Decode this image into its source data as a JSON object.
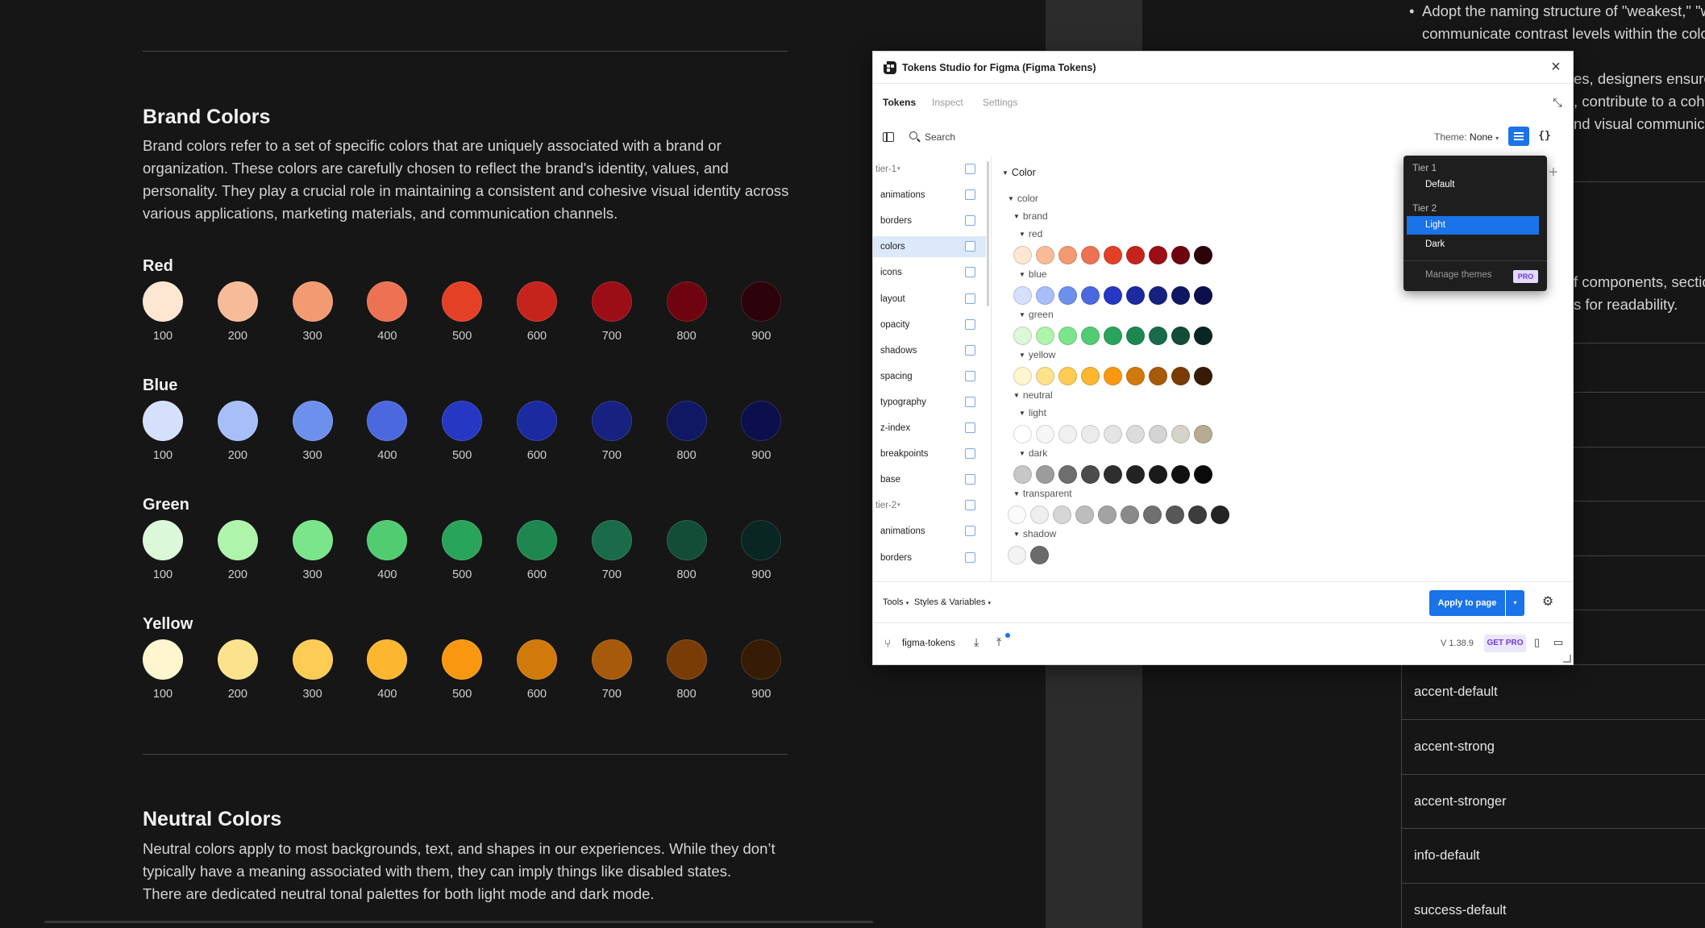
{
  "doc": {
    "brand_title": "Brand Colors",
    "brand_paragraph": [
      "Brand colors refer to a set of specific colors that are uniquely associated with a brand or",
      "organization. These colors are carefully chosen to reflect the brand's identity, values, and",
      "personality. They play a crucial role in maintaining a consistent and cohesive visual identity across",
      "various applications, marketing materials, and communication channels."
    ],
    "palettes": [
      {
        "name": "Red",
        "colors": [
          "#fde6d2",
          "#f8bb97",
          "#f29a72",
          "#ec7253",
          "#e44026",
          "#c4241c",
          "#9b0e16",
          "#6f0411",
          "#2c030a"
        ]
      },
      {
        "name": "Blue",
        "colors": [
          "#d5e0fc",
          "#a7bef9",
          "#6e90ed",
          "#4c68de",
          "#2637c3",
          "#1c2a9f",
          "#17217f",
          "#101763",
          "#0c0f4c"
        ]
      },
      {
        "name": "Green",
        "colors": [
          "#dbf8d8",
          "#aef4ab",
          "#7be58b",
          "#52cc71",
          "#28a45b",
          "#1e874f",
          "#1a6b49",
          "#134c37",
          "#0a2622"
        ]
      },
      {
        "name": "Yellow",
        "colors": [
          "#fff5cf",
          "#fde28c",
          "#fdcc55",
          "#fcb62f",
          "#f99810",
          "#d07a0b",
          "#a75a09",
          "#7a3c07",
          "#361b06"
        ]
      }
    ],
    "steps": [
      "100",
      "200",
      "300",
      "400",
      "500",
      "600",
      "700",
      "800",
      "900"
    ],
    "neutral_title": "Neutral Colors",
    "neutral_paragraph": [
      "Neutral colors apply to most backgrounds, text, and shapes in our experiences. While they don’t",
      "typically have a meaning associated with them, they can imply things like disabled states.",
      "There are dedicated neutral tonal palettes for both light mode and dark mode."
    ]
  },
  "right_doc": {
    "bullet_line1": "Adopt the naming structure of \"weakest,\" \"w",
    "bullet_line2": "communicate contrast levels within the colo",
    "frag1": "es, designers ensure",
    "frag2": ", contribute to a coh",
    "frag3": "nd visual communica",
    "frag4": "f components, sectio",
    "frag5": "s for readability.",
    "tokens": [
      "accent-default",
      "accent-strong",
      "accent-stronger",
      "info-default",
      "success-default"
    ]
  },
  "plugin": {
    "title": "Tokens Studio for Figma (Figma Tokens)",
    "tabs": [
      "Tokens",
      "Inspect",
      "Settings"
    ],
    "active_tab": "Tokens",
    "search_placeholder": "Search",
    "theme_label": "Theme:",
    "theme_value": "None",
    "sets": [
      {
        "label": "tier-1",
        "group": true
      },
      {
        "label": "animations"
      },
      {
        "label": "borders"
      },
      {
        "label": "colors",
        "active": true
      },
      {
        "label": "icons"
      },
      {
        "label": "layout"
      },
      {
        "label": "opacity"
      },
      {
        "label": "shadows"
      },
      {
        "label": "spacing"
      },
      {
        "label": "typography"
      },
      {
        "label": "z-index"
      },
      {
        "label": "breakpoints"
      },
      {
        "label": "base"
      },
      {
        "label": "tier-2",
        "group": true
      },
      {
        "label": "animations"
      },
      {
        "label": "borders"
      }
    ],
    "token_tree": [
      {
        "label": "Color",
        "level": 0
      },
      {
        "label": "color",
        "level": 1
      },
      {
        "label": "brand",
        "level": 2
      },
      {
        "label": "red",
        "level": 3,
        "colors": [
          "#fde6d2",
          "#f8bb97",
          "#f29a72",
          "#ec7253",
          "#e44026",
          "#c4241c",
          "#9b0e16",
          "#6f0411",
          "#2c030a"
        ]
      },
      {
        "label": "blue",
        "level": 3,
        "colors": [
          "#d5e0fc",
          "#a7bef9",
          "#6e90ed",
          "#4c68de",
          "#2637c3",
          "#1c2a9f",
          "#17217f",
          "#101763",
          "#0c0f4c"
        ]
      },
      {
        "label": "green",
        "level": 3,
        "colors": [
          "#dbf8d8",
          "#aef4ab",
          "#7be58b",
          "#52cc71",
          "#28a45b",
          "#1e874f",
          "#1a6b49",
          "#134c37",
          "#0a2622"
        ]
      },
      {
        "label": "yellow",
        "level": 3,
        "colors": [
          "#fff5cf",
          "#fde28c",
          "#fdcc55",
          "#fcb62f",
          "#f99810",
          "#d07a0b",
          "#a75a09",
          "#7a3c07",
          "#361b06"
        ]
      },
      {
        "label": "neutral",
        "level": 2
      },
      {
        "label": "light",
        "level": 3,
        "colors": [
          "#ffffff",
          "#f6f6f6",
          "#f0f0f0",
          "#ebebeb",
          "#e4e4e4",
          "#dcdcdc",
          "#d4d4d4",
          "#d6d3cb",
          "#b7ab91"
        ]
      },
      {
        "label": "dark",
        "level": 3,
        "colors": [
          "#c7c7c7",
          "#9c9c9c",
          "#6e6e6e",
          "#4c4c4c",
          "#2e2e2e",
          "#232323",
          "#1a1a1a",
          "#111111",
          "#0a0a0a"
        ]
      },
      {
        "label": "transparent",
        "level": 2,
        "colors": [
          "#fbfbfb",
          "#eeeeee",
          "#d6d6d6",
          "#bdbdbd",
          "#a3a3a3",
          "#8a8a8a",
          "#707070",
          "#575757",
          "#3d3d3d",
          "#242424"
        ]
      },
      {
        "label": "shadow",
        "level": 2,
        "colors": [
          "#f3f3f3",
          "#6b6b6b"
        ]
      }
    ],
    "bottom": {
      "tools": "Tools",
      "styles_vars": "Styles & Variables",
      "apply": "Apply to page"
    },
    "footer": {
      "branch": "figma-tokens",
      "version": "V 1.38.9",
      "get_pro": "GET PRO"
    }
  },
  "theme_dropdown": {
    "groups": [
      {
        "label": "Tier 1",
        "items": [
          {
            "label": "Default"
          }
        ]
      },
      {
        "label": "Tier 2",
        "items": [
          {
            "label": "Light",
            "selected": true
          },
          {
            "label": "Dark"
          }
        ]
      }
    ],
    "manage": "Manage themes",
    "pro_badge": "PRO"
  },
  "colors": {
    "accent_blue": "#1a73e8",
    "doc_bg": "#161616",
    "strip_bg": "#2c2c2c",
    "dropdown_bg": "#1e1e1e"
  }
}
